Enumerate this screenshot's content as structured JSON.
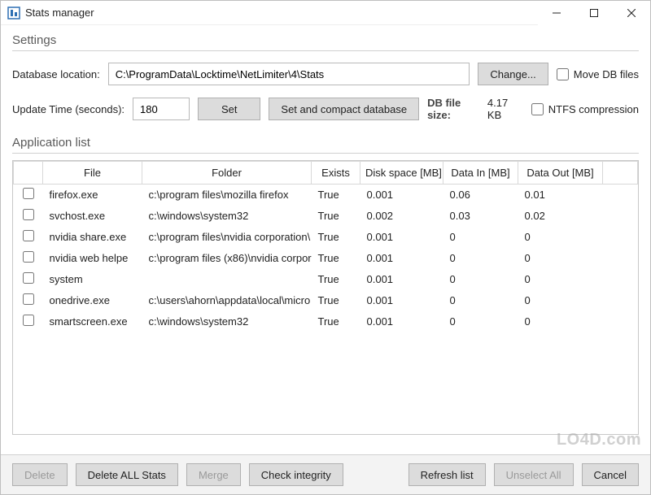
{
  "window": {
    "title": "Stats manager"
  },
  "settings": {
    "header": "Settings",
    "db_location_label": "Database location:",
    "db_location_value": "C:\\ProgramData\\Locktime\\NetLimiter\\4\\Stats",
    "change_btn": "Change...",
    "move_db_label": "Move DB files",
    "update_time_label": "Update Time (seconds):",
    "update_time_value": "180",
    "set_btn": "Set",
    "set_compact_btn": "Set and compact database",
    "db_size_label": "DB file size:",
    "db_size_value": "4.17 KB",
    "ntfs_label": "NTFS compression"
  },
  "applist": {
    "header": "Application list",
    "columns": {
      "file": "File",
      "folder": "Folder",
      "exists": "Exists",
      "disk": "Disk space [MB]",
      "data_in": "Data In [MB]",
      "data_out": "Data Out [MB]"
    },
    "rows": [
      {
        "file": "firefox.exe",
        "folder": "c:\\program files\\mozilla firefox",
        "exists": "True",
        "disk": "0.001",
        "in": "0.06",
        "out": "0.01"
      },
      {
        "file": "svchost.exe",
        "folder": "c:\\windows\\system32",
        "exists": "True",
        "disk": "0.002",
        "in": "0.03",
        "out": "0.02"
      },
      {
        "file": "nvidia share.exe",
        "folder": "c:\\program files\\nvidia corporation\\",
        "exists": "True",
        "disk": "0.001",
        "in": "0",
        "out": "0"
      },
      {
        "file": "nvidia web helpe",
        "folder": "c:\\program files (x86)\\nvidia corpora",
        "exists": "True",
        "disk": "0.001",
        "in": "0",
        "out": "0"
      },
      {
        "file": "system",
        "folder": "",
        "exists": "True",
        "disk": "0.001",
        "in": "0",
        "out": "0"
      },
      {
        "file": "onedrive.exe",
        "folder": "c:\\users\\ahorn\\appdata\\local\\micro",
        "exists": "True",
        "disk": "0.001",
        "in": "0",
        "out": "0"
      },
      {
        "file": "smartscreen.exe",
        "folder": "c:\\windows\\system32",
        "exists": "True",
        "disk": "0.001",
        "in": "0",
        "out": "0"
      }
    ]
  },
  "footer": {
    "delete": "Delete",
    "delete_all": "Delete ALL Stats",
    "merge": "Merge",
    "check": "Check integrity",
    "refresh": "Refresh list",
    "unselect": "Unselect All",
    "cancel": "Cancel"
  },
  "watermark": "LO4D.com"
}
